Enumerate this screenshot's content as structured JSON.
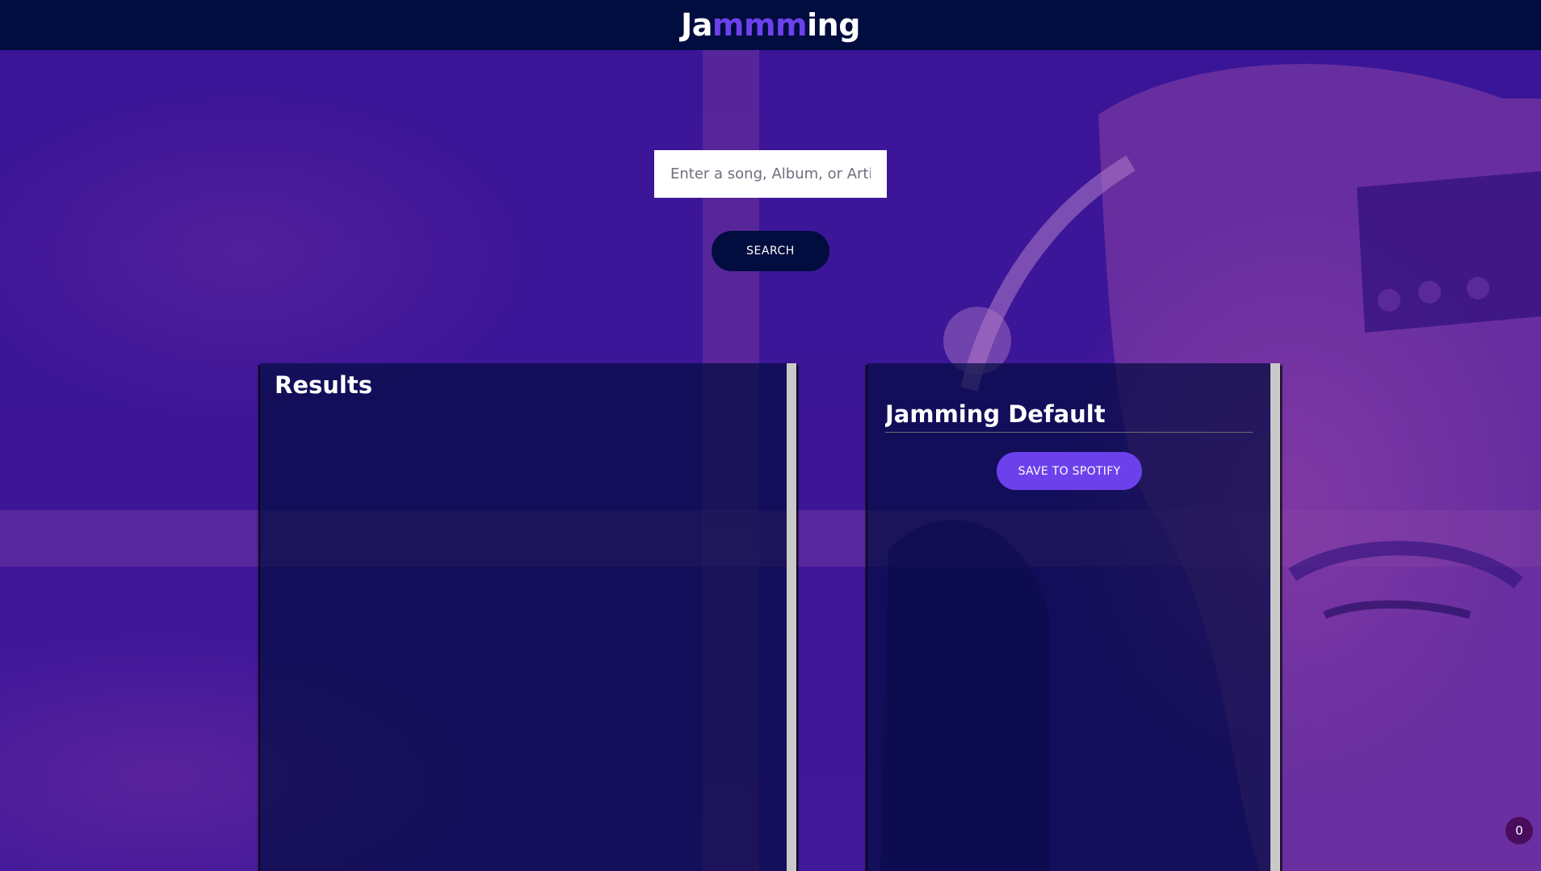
{
  "header": {
    "logo_prefix": "Ja",
    "logo_accent": "mmm",
    "logo_suffix": "ing"
  },
  "search": {
    "placeholder": "Enter a song, Album, or Artist",
    "value": "",
    "button_label": "SEARCH"
  },
  "results": {
    "title": "Results",
    "tracks": []
  },
  "playlist": {
    "name": "Jamming Default",
    "save_label": "SAVE TO SPOTIFY",
    "tracks": []
  },
  "badge": {
    "count": "0"
  },
  "colors": {
    "header_bg": "#010c3f",
    "accent": "#6c41ec",
    "background": "#3a1494",
    "panel_bg": "#010c3f"
  }
}
